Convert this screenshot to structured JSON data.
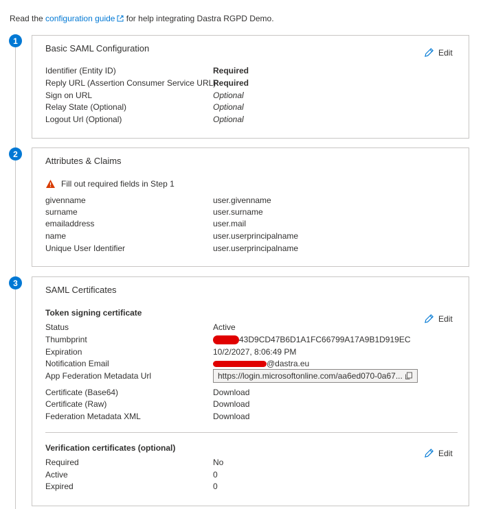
{
  "intro": {
    "prefix": "Read the ",
    "link": "configuration guide",
    "suffix": " for help integrating Dastra RGPD Demo."
  },
  "steps": [
    "1",
    "2",
    "3"
  ],
  "edit_label": "Edit",
  "saml_basic": {
    "title": "Basic SAML Configuration",
    "rows": [
      {
        "key": "Identifier (Entity ID)",
        "value": "Required"
      },
      {
        "key": "Reply URL (Assertion Consumer Service URL)",
        "value": "Required"
      },
      {
        "key": "Sign on URL",
        "value": "Optional"
      },
      {
        "key": "Relay State (Optional)",
        "value": "Optional"
      },
      {
        "key": "Logout Url (Optional)",
        "value": "Optional"
      }
    ]
  },
  "attributes": {
    "title": "Attributes & Claims",
    "warning": "Fill out required fields in Step 1",
    "rows": [
      {
        "key": "givenname",
        "value": "user.givenname"
      },
      {
        "key": "surname",
        "value": "user.surname"
      },
      {
        "key": "emailaddress",
        "value": "user.mail"
      },
      {
        "key": "name",
        "value": "user.userprincipalname"
      },
      {
        "key": "Unique User Identifier",
        "value": "user.userprincipalname"
      }
    ]
  },
  "certificates": {
    "title": "SAML Certificates",
    "token_heading": "Token signing certificate",
    "status": {
      "key": "Status",
      "value": "Active"
    },
    "thumbprint": {
      "key": "Thumbprint",
      "value": "43D9CD47B6D1A1FC66799A17A9B1D919EC"
    },
    "expiration": {
      "key": "Expiration",
      "value": "10/2/2027, 8:06:49 PM"
    },
    "notification": {
      "key": "Notification Email",
      "value": "@dastra.eu"
    },
    "metadata_url": {
      "key": "App Federation Metadata Url",
      "value": "https://login.microsoftonline.com/aa6ed070-0a67..."
    },
    "downloads": [
      {
        "key": "Certificate (Base64)",
        "value": "Download"
      },
      {
        "key": "Certificate (Raw)",
        "value": "Download"
      },
      {
        "key": "Federation Metadata XML",
        "value": "Download"
      }
    ],
    "verification_heading": "Verification certificates (optional)",
    "verification_rows": [
      {
        "key": "Required",
        "value": "No"
      },
      {
        "key": "Active",
        "value": "0"
      },
      {
        "key": "Expired",
        "value": "0"
      }
    ]
  }
}
